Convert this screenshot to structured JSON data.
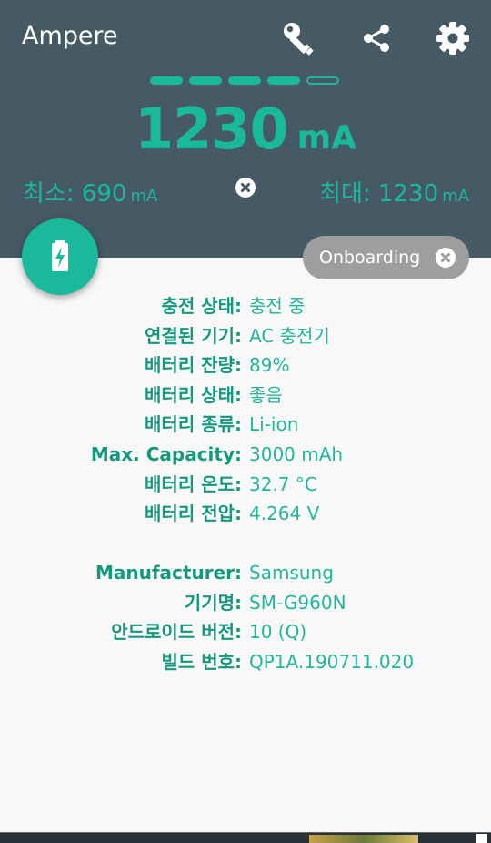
{
  "app": {
    "title": "Ampere"
  },
  "toolbar": {
    "icons": [
      "key-icon",
      "share-icon",
      "settings-icon"
    ]
  },
  "meter": {
    "segments_total": 5,
    "segments_filled": 4,
    "current_value": "1230",
    "current_unit": "mA",
    "min_label": "최소: 690",
    "min_unit": "mA",
    "max_label": "최대: 1230",
    "max_unit": "mA"
  },
  "chip": {
    "label": "Onboarding"
  },
  "info": {
    "charging_status": {
      "label": "충전 상태:",
      "value": "충전 중"
    },
    "plugged": {
      "label": "연결된 기기:",
      "value": "AC 충전기"
    },
    "level": {
      "label": "배터리 잔량:",
      "value": "89%"
    },
    "health": {
      "label": "배터리 상태:",
      "value": "좋음"
    },
    "technology": {
      "label": "배터리 종류:",
      "value": "Li-ion"
    },
    "capacity": {
      "label": "Max. Capacity:",
      "value": "3000 mAh"
    },
    "temperature": {
      "label": "배터리 온도:",
      "value": "32.7 °C"
    },
    "voltage": {
      "label": "배터리 전압:",
      "value": "4.264 V"
    }
  },
  "device": {
    "manufacturer": {
      "label": "Manufacturer:",
      "value": "Samsung"
    },
    "model": {
      "label": "기기명:",
      "value": "SM-G960N"
    },
    "android": {
      "label": "안드로이드 버전:",
      "value": "10 (Q)"
    },
    "build": {
      "label": "빌드 번호:",
      "value": "QP1A.190711.020"
    }
  },
  "colors": {
    "header": "#455a64",
    "accent": "#1ab99c",
    "label": "#14997f",
    "chip": "#9e9e9e",
    "background": "#f8f8f8"
  }
}
